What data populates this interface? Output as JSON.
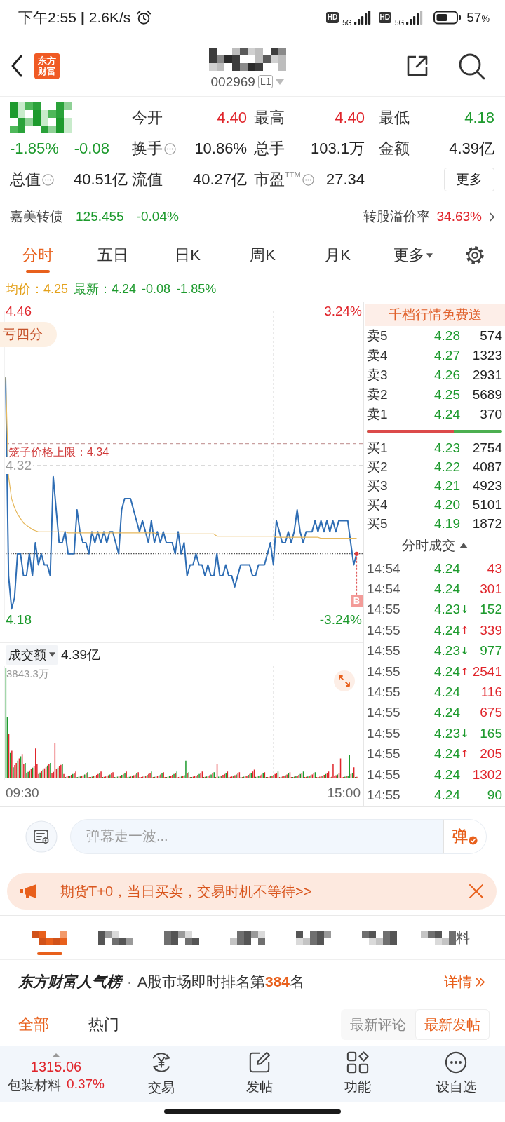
{
  "status_bar": {
    "time": "下午2:55",
    "separator": "|",
    "speed": "2.6K/s",
    "sims": [
      {
        "badge": "HD",
        "network": "5G"
      },
      {
        "badge": "HD",
        "network": "5G"
      }
    ],
    "battery_value": "57",
    "battery_unit": "%"
  },
  "header": {
    "logo": [
      "东方",
      "财富"
    ],
    "code": "002969",
    "level_badge": "L1"
  },
  "quote": {
    "change_pct": "-1.85%",
    "change": "-0.08",
    "stats": [
      {
        "label": "今开",
        "value": "4.40",
        "color": "#e0252b"
      },
      {
        "label": "最高",
        "value": "4.40",
        "color": "#e0252b"
      },
      {
        "label": "最低",
        "value": "4.18",
        "color": "#1d9a2d"
      },
      {
        "label": "换手",
        "value": "10.86%",
        "color": "#222222",
        "info": true
      },
      {
        "label": "总手",
        "value": "103.1万",
        "color": "#222222"
      },
      {
        "label": "金额",
        "value": "4.39亿",
        "color": "#222222"
      },
      {
        "label": "总值",
        "value": "40.51亿",
        "color": "#222222",
        "info": true
      },
      {
        "label": "流值",
        "value": "40.27亿",
        "color": "#222222"
      },
      {
        "label": "市盈$^{TTM}$",
        "value": "27.34",
        "color": "#222222",
        "info": true
      }
    ],
    "more_button": "更多"
  },
  "bond": {
    "name": "嘉美转债",
    "price": "125.455",
    "change": "-0.04%",
    "premium_label": "转股溢价率",
    "premium_value": "34.63%"
  },
  "chart_tabs": [
    {
      "label": "分时",
      "selected": true,
      "kind": "tab"
    },
    {
      "label": "五日",
      "selected": false,
      "kind": "tab"
    },
    {
      "label": "日K",
      "selected": false,
      "kind": "tab"
    },
    {
      "label": "周K",
      "selected": false,
      "kind": "tab"
    },
    {
      "label": "月K",
      "selected": false,
      "kind": "tab"
    },
    {
      "label": "更多",
      "selected": false,
      "kind": "dropdown"
    }
  ],
  "chart_info": {
    "avg_label": "均价：",
    "avg_value": "4.25",
    "latest_label": "最新：",
    "latest_value": "4.24",
    "change": "-0.08",
    "change_pct": "-1.85%"
  },
  "price_chart": {
    "tag": "亏四分",
    "right_axis": [
      {
        "label": "3.24%",
        "color": "#e0252b"
      },
      {
        "label": "-3.24%",
        "color": "#1d9a2d"
      }
    ],
    "chart_data": {
      "type": "line",
      "series": [
        {
          "color": "#2e6db4",
          "values": [
            4.4,
            4.22,
            4.19,
            4.2,
            4.24,
            4.24,
            4.22,
            4.22,
            4.24,
            4.22,
            4.25,
            4.23,
            4.24,
            4.23,
            4.23,
            4.22,
            4.31,
            4.28,
            4.25,
            4.25,
            4.26,
            4.24,
            4.24,
            4.24,
            4.28,
            4.26,
            4.25,
            4.25,
            4.24,
            4.26,
            4.25,
            4.26,
            4.25,
            4.26,
            4.25,
            4.26,
            4.26,
            4.25,
            4.24,
            4.28,
            4.29,
            4.29,
            4.29,
            4.28,
            4.27,
            4.26,
            4.27,
            4.26,
            4.25,
            4.27,
            4.25,
            4.26,
            4.25,
            4.26,
            4.25,
            4.25,
            4.25,
            4.24,
            4.26,
            4.24,
            4.25,
            4.22,
            4.23,
            4.23,
            4.24,
            4.23,
            4.23,
            4.22,
            4.23,
            4.22,
            4.22,
            4.24,
            4.22,
            4.22,
            4.23,
            4.22,
            4.22,
            4.21,
            4.22,
            4.23,
            4.23,
            4.23,
            4.23,
            4.22,
            4.22,
            4.23,
            4.23,
            4.23,
            4.24,
            4.25,
            4.23,
            4.27,
            4.26,
            4.25,
            4.25,
            4.26,
            4.25,
            4.26,
            4.28,
            4.26,
            4.25,
            4.26,
            4.26,
            4.26,
            4.27,
            4.26,
            4.27,
            4.26,
            4.27,
            4.26,
            4.27,
            4.26,
            4.27,
            4.27,
            4.27,
            4.27,
            4.25,
            4.23,
            4.24
          ]
        },
        {
          "color": "#e6b85c",
          "values": [
            4.4,
            4.31,
            4.29,
            4.282,
            4.276,
            4.272,
            4.268,
            4.266,
            4.264,
            4.262,
            4.261,
            4.26,
            4.26,
            4.26,
            4.26,
            4.26,
            4.26,
            4.26,
            4.26,
            4.26,
            4.26,
            4.259,
            4.259,
            4.259,
            4.259,
            4.259,
            4.259,
            4.259,
            4.259,
            4.259,
            4.259,
            4.259,
            4.259,
            4.259,
            4.259,
            4.259,
            4.259,
            4.259,
            4.259,
            4.259,
            4.259,
            4.259,
            4.259,
            4.259,
            4.259,
            4.259,
            4.259,
            4.259,
            4.259,
            4.259,
            4.259,
            4.258,
            4.258,
            4.258,
            4.258,
            4.258,
            4.258,
            4.258,
            4.258,
            4.258,
            4.258,
            4.258,
            4.258,
            4.258,
            4.258,
            4.258,
            4.258,
            4.258,
            4.258,
            4.258,
            4.258,
            4.256,
            4.256,
            4.256,
            4.256,
            4.256,
            4.256,
            4.256,
            4.256,
            4.256,
            4.256,
            4.256,
            4.256,
            4.256,
            4.256,
            4.256,
            4.256,
            4.256,
            4.256,
            4.256,
            4.256,
            4.255,
            4.255,
            4.255,
            4.255,
            4.255,
            4.255,
            4.255,
            4.255,
            4.255,
            4.255,
            4.255,
            4.255,
            4.255,
            4.255,
            4.255,
            4.254,
            4.254,
            4.254,
            4.254,
            4.254,
            4.254,
            4.254,
            4.254,
            4.254,
            4.254,
            4.254,
            4.254,
            4.254
          ]
        }
      ],
      "ylim": [
        4.18,
        4.46
      ],
      "yticks": [
        {
          "value": 4.46,
          "label": "4.46"
        },
        {
          "value": 4.32,
          "label": "4.32"
        },
        {
          "value": 4.18,
          "label": "4.18"
        }
      ],
      "ref_lines": [
        {
          "axis": "y",
          "value": 4.34,
          "label": "笼子价格上限：4.34",
          "color": "#c9a0a0"
        },
        {
          "axis": "y",
          "value": 4.32,
          "color": "#b5b5b5"
        },
        {
          "axis": "y",
          "value": 4.24,
          "color": "#555555"
        }
      ],
      "annotations": [
        "B"
      ]
    }
  },
  "volume_chart": {
    "metric": "成交额",
    "total": "4.39亿",
    "max_label": "3843.3万",
    "time_labels": [
      "09:30",
      "15:00"
    ]
  },
  "order_book": {
    "banner": "千档行情免费送",
    "asks": [
      {
        "label": "卖5",
        "price": "4.28",
        "volume": "574"
      },
      {
        "label": "卖4",
        "price": "4.27",
        "volume": "1323"
      },
      {
        "label": "卖3",
        "price": "4.26",
        "volume": "2931"
      },
      {
        "label": "卖2",
        "price": "4.25",
        "volume": "5689"
      },
      {
        "label": "卖1",
        "price": "4.24",
        "volume": "370"
      }
    ],
    "ratio": {
      "level": 0.64
    },
    "bids": [
      {
        "label": "买1",
        "price": "4.23",
        "volume": "2754"
      },
      {
        "label": "买2",
        "price": "4.22",
        "volume": "4087"
      },
      {
        "label": "买3",
        "price": "4.21",
        "volume": "4923"
      },
      {
        "label": "买4",
        "price": "4.20",
        "volume": "5101"
      },
      {
        "label": "买5",
        "price": "4.19",
        "volume": "1872"
      }
    ],
    "trades_title": "分时成交",
    "trades": [
      {
        "time": "14:54",
        "price": "4.24",
        "volume": "43",
        "color": "#e0252b"
      },
      {
        "time": "14:54",
        "price": "4.24",
        "volume": "301",
        "color": "#e0252b"
      },
      {
        "time": "14:55",
        "price": "4.23",
        "arrow": "↓",
        "volume": "152",
        "color": "#1d9a2d"
      },
      {
        "time": "14:55",
        "price": "4.24",
        "arrow": "↑",
        "volume": "339",
        "color": "#e0252b"
      },
      {
        "time": "14:55",
        "price": "4.23",
        "arrow": "↓",
        "volume": "977",
        "color": "#1d9a2d"
      },
      {
        "time": "14:55",
        "price": "4.24",
        "arrow": "↑",
        "volume": "2541",
        "color": "#e0252b"
      },
      {
        "time": "14:55",
        "price": "4.24",
        "volume": "116",
        "color": "#e0252b"
      },
      {
        "time": "14:55",
        "price": "4.24",
        "volume": "675",
        "color": "#e0252b"
      },
      {
        "time": "14:55",
        "price": "4.23",
        "arrow": "↓",
        "volume": "165",
        "color": "#1d9a2d"
      },
      {
        "time": "14:55",
        "price": "4.24",
        "arrow": "↑",
        "volume": "205",
        "color": "#e0252b"
      },
      {
        "time": "14:55",
        "price": "4.24",
        "volume": "1302",
        "color": "#e0252b"
      },
      {
        "time": "14:55",
        "price": "4.24",
        "volume": "90",
        "color": "#1d9a2d"
      }
    ]
  },
  "comment_bar": {
    "placeholder": "弹幕走一波...",
    "send_label": "弹"
  },
  "promo": {
    "text": "期货T+0，当日买卖，交易时机不等待>>"
  },
  "section_tabs": [
    {
      "selected": true
    },
    {
      "selected": false
    },
    {
      "selected": false
    },
    {
      "selected": false
    },
    {
      "selected": false
    },
    {
      "selected": false
    },
    {
      "selected": false,
      "visible_text": "料"
    }
  ],
  "ranking": {
    "brand": "东方财富人气榜",
    "separator": "·",
    "text": "A股市场即时排名第**384**名",
    "link": "详情"
  },
  "post_tabs": {
    "tabs": [
      {
        "label": "全部",
        "selected": true
      },
      {
        "label": "热门",
        "selected": false
      }
    ],
    "sort": [
      {
        "label": "最新评论",
        "selected": false
      },
      {
        "label": "最新发帖",
        "selected": true
      }
    ]
  },
  "bottom_nav": {
    "index_value": "1315.06",
    "index_name": "包装材料",
    "index_change": "0.37%",
    "items": [
      {
        "label": "交易",
        "kind": "trade"
      },
      {
        "label": "发帖",
        "kind": "post"
      },
      {
        "label": "功能",
        "kind": "apps"
      },
      {
        "label": "设自选",
        "kind": "more"
      }
    ]
  }
}
